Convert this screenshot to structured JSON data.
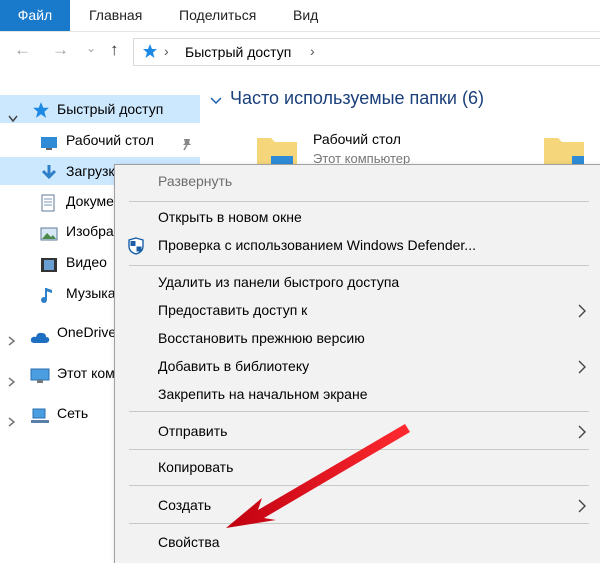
{
  "ribbon": {
    "tabs": [
      "Файл",
      "Главная",
      "Поделиться",
      "Вид"
    ]
  },
  "address": {
    "path": "Быстрый доступ",
    "separator": "›"
  },
  "nav": {
    "back": "←",
    "forward": "→",
    "up": "↑",
    "chevron": "⌄"
  },
  "sidebar": {
    "quick_access": "Быстрый доступ",
    "items": [
      "Рабочий стол",
      "Загрузки",
      "Документы",
      "Изображения",
      "Видео",
      "Музыка"
    ],
    "onedrive": "OneDrive",
    "this_pc": "Этот компьютер",
    "network": "Сеть"
  },
  "main": {
    "group_title": "Часто используемые папки (6)",
    "folder_name": "Рабочий стол",
    "folder_sub": "Этот компьютер"
  },
  "context_menu": {
    "items": [
      "Развернуть",
      "Открыть в новом окне",
      "Проверка с использованием Windows Defender...",
      "Удалить из панели быстрого доступа",
      "Предоставить доступ к",
      "Восстановить прежнюю версию",
      "Добавить в библиотеку",
      "Закрепить на начальном экране",
      "Отправить",
      "Копировать",
      "Создать",
      "Свойства"
    ]
  },
  "colors": {
    "accent": "#1979ca",
    "selection": "#cce8ff",
    "menu_bg": "#f2f2f2",
    "arrow_red": "#e0141b"
  }
}
